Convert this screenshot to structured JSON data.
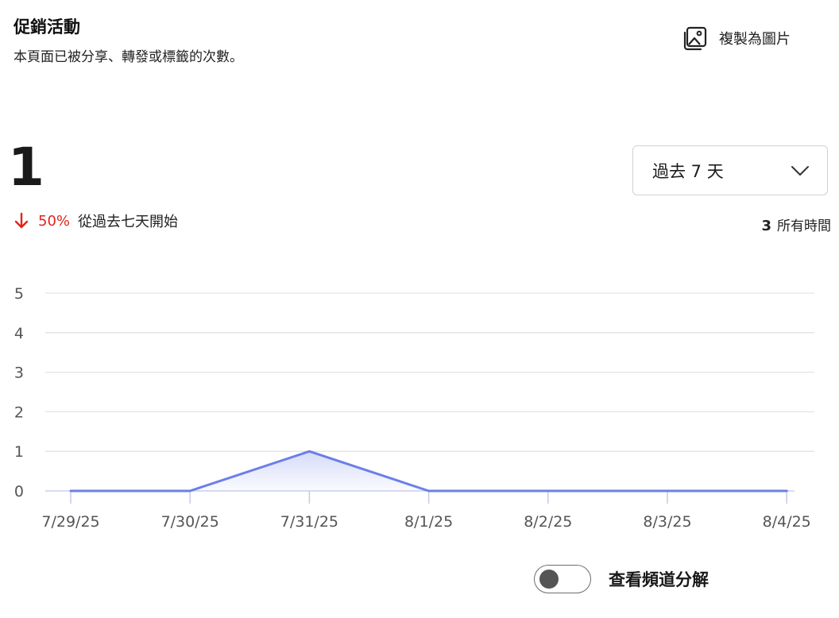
{
  "header": {
    "title": "促銷活動",
    "subtitle": "本頁面已被分享、轉發或標籤的次數。",
    "copy_label": "複製為圖片",
    "copy_icon": "image-icon"
  },
  "summary": {
    "value": "1",
    "change_percent": "50%",
    "change_direction": "down",
    "change_color": "#e0241b",
    "change_text": "從過去七天開始",
    "alltime_value": "3",
    "alltime_label": "所有時間"
  },
  "filter": {
    "selected": "過去 7 天"
  },
  "toggle": {
    "label": "查看頻道分解",
    "state": "off"
  },
  "chart_data": {
    "type": "area",
    "categories": [
      "7/29/25",
      "7/30/25",
      "7/31/25",
      "8/1/25",
      "8/2/25",
      "8/3/25",
      "8/4/25"
    ],
    "series": [
      {
        "values": [
          0,
          0,
          1,
          0,
          0,
          0,
          0
        ],
        "color": "#6b7fe6"
      }
    ],
    "ylim": [
      0,
      5
    ],
    "yticks": [
      0,
      1,
      2,
      3,
      4,
      5
    ],
    "grid": true,
    "title": "",
    "xlabel": "",
    "ylabel": ""
  }
}
